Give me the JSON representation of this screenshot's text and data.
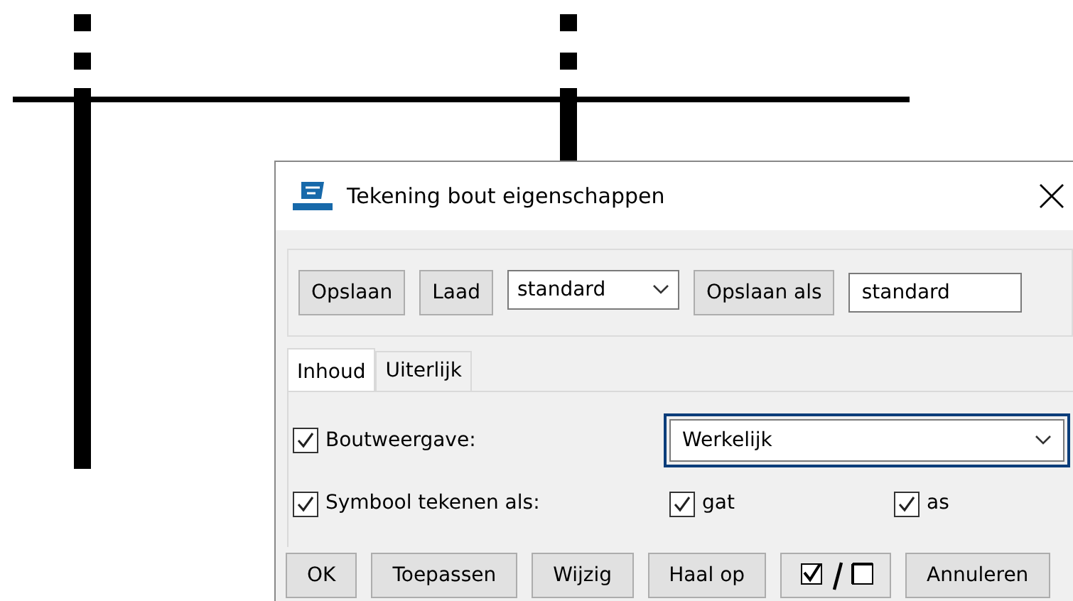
{
  "window": {
    "title": "Tekening bout eigenschappen"
  },
  "toolbar": {
    "buttons": [
      "Opslaan",
      "Laad"
    ],
    "load_combo": {
      "value": "standard"
    },
    "save_as_button": "Opslaan als",
    "save_as_field": {
      "value": "standard"
    }
  },
  "tabs": [
    {
      "label": "Inhoud",
      "selected": true
    },
    {
      "label": "Uiterlijk",
      "selected": false
    }
  ],
  "bolt_display": {
    "label": "Boutweergave:",
    "checked": true,
    "value": "Werkelijk"
  },
  "symbol": {
    "label": "Symbool tekenen als:",
    "checked": true,
    "options": [
      {
        "label": "gat",
        "checked": true
      },
      {
        "label": "as",
        "checked": true
      }
    ]
  },
  "buttons": [
    {
      "kind": "text",
      "label": "OK"
    },
    {
      "kind": "text",
      "label": "Toepassen"
    },
    {
      "kind": "text",
      "label": "Wijzig"
    },
    {
      "kind": "text",
      "label": "Haal op"
    },
    {
      "kind": "toggle"
    },
    {
      "kind": "text",
      "label": "Annuleren"
    }
  ]
}
